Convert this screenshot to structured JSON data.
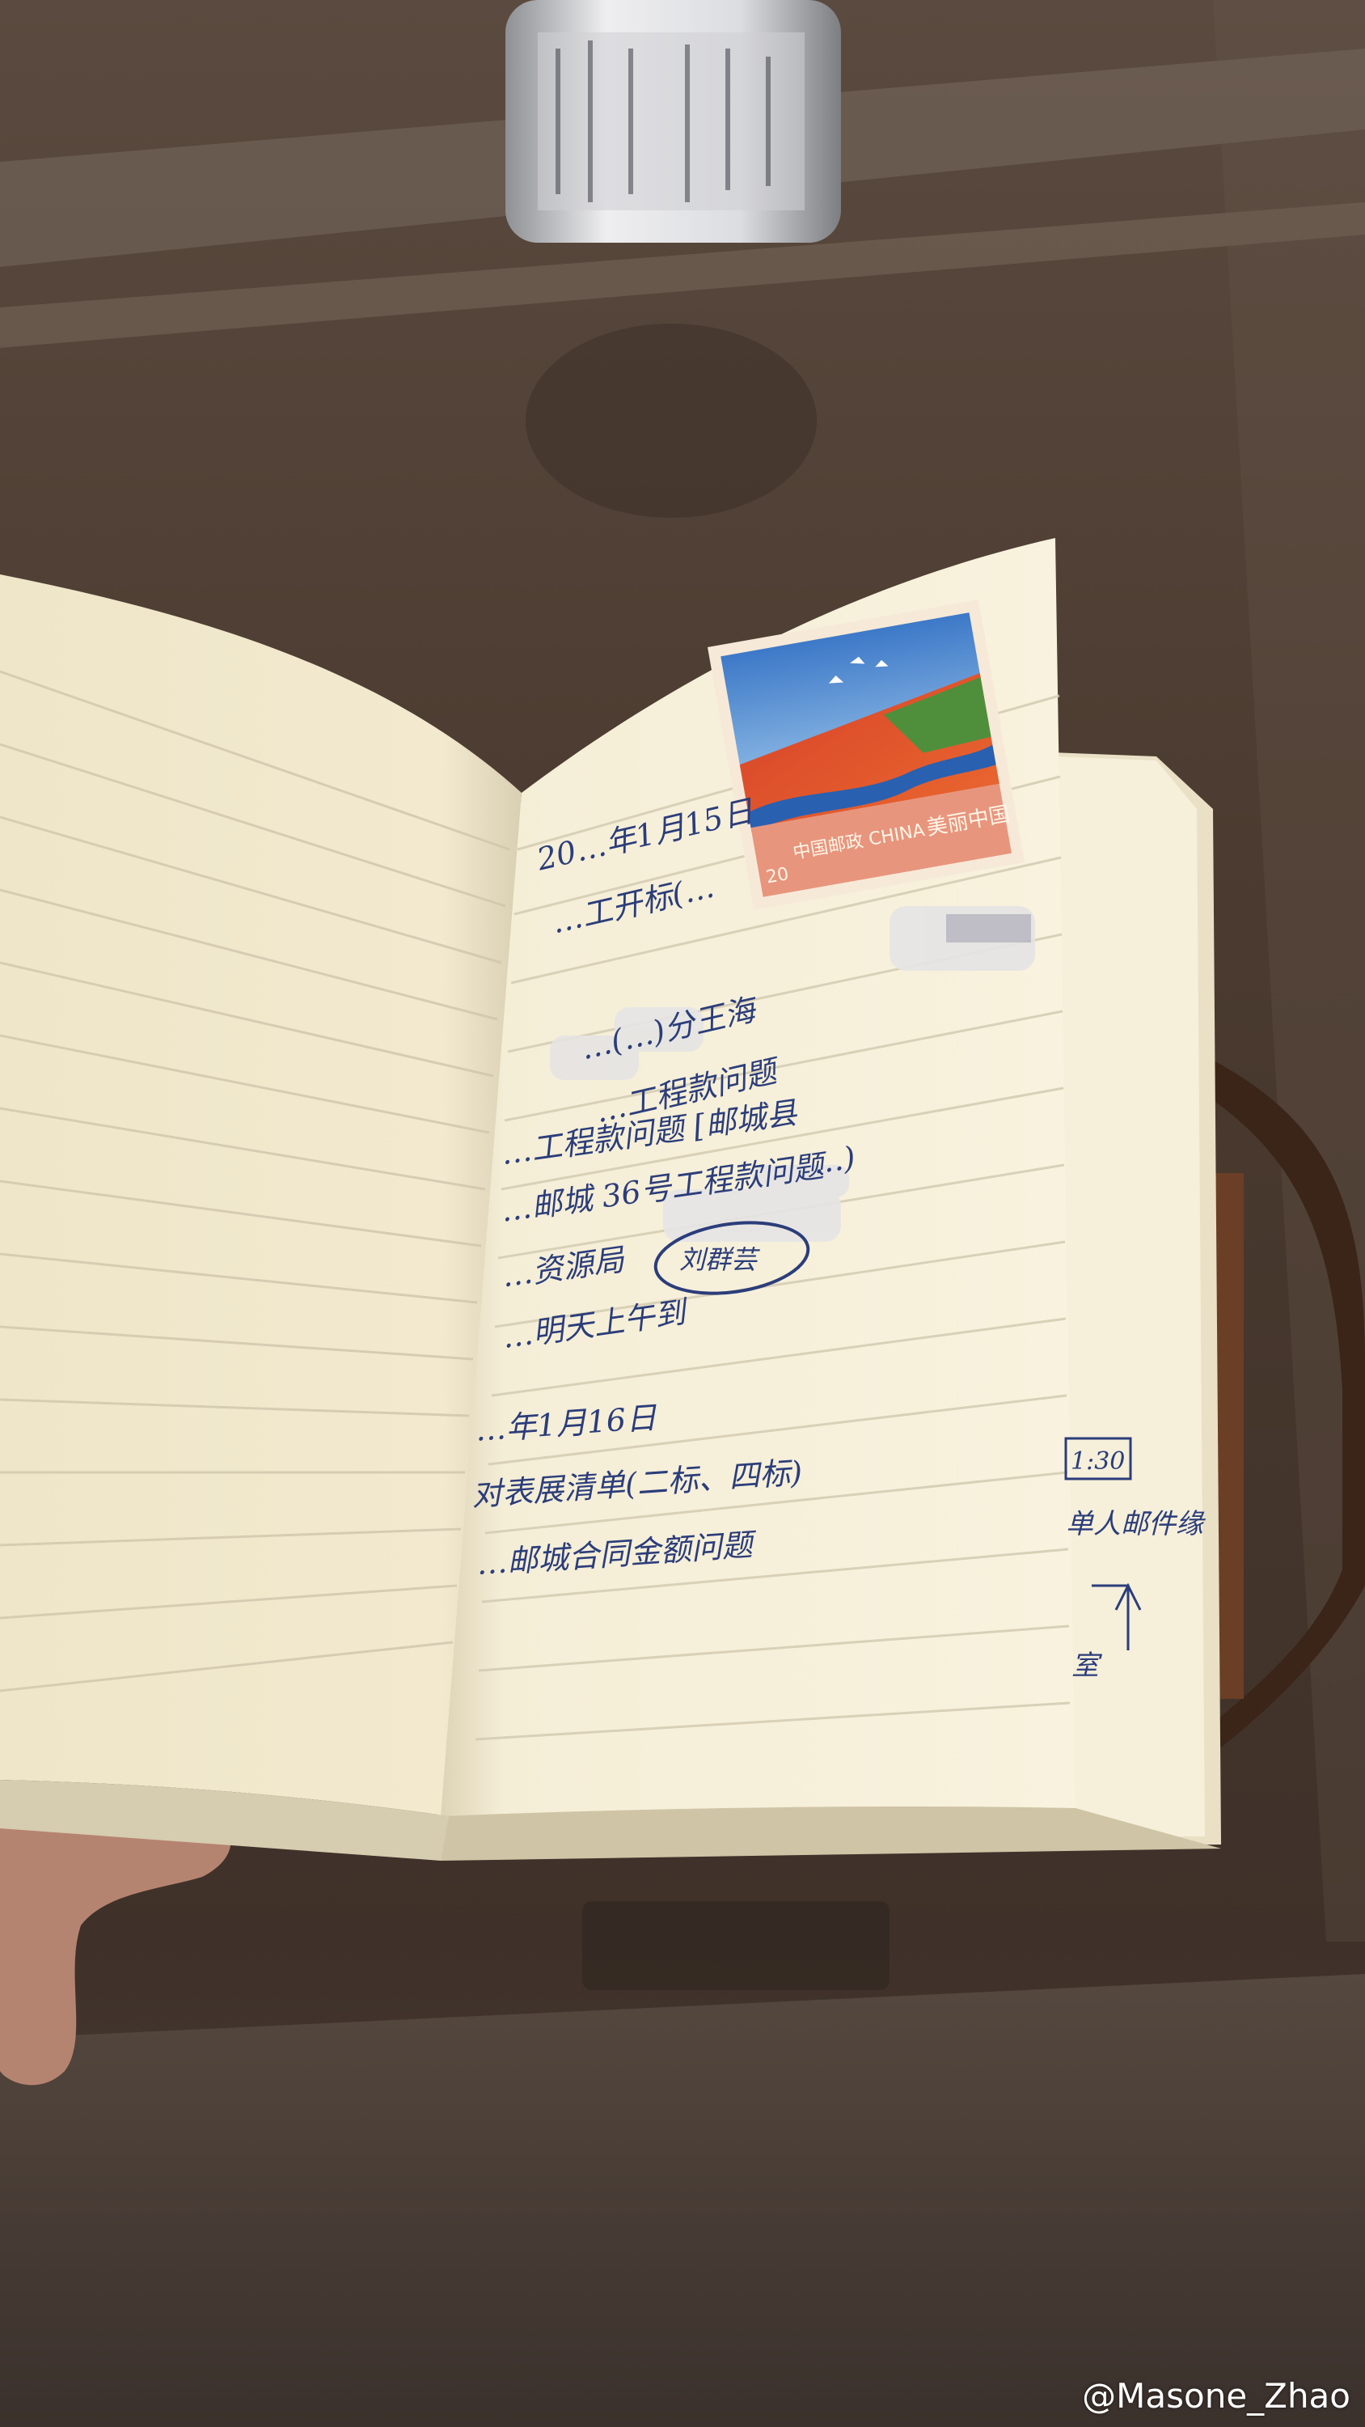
{
  "notebook": {
    "lines": [
      {
        "text": "20…年1月15日"
      },
      {
        "text": "…工开标(…"
      },
      {
        "text": "…(…)分王海"
      },
      {
        "text": "…工程款问题"
      },
      {
        "text": "…工程款问题 [邮城县"
      },
      {
        "text": "…邮城 36号工程款问题"
      },
      {
        "text": "…)"
      },
      {
        "text": "…资源局"
      },
      {
        "text": "…明天上午到"
      },
      {
        "text": "刘群芸"
      },
      {
        "text": "…年1月16日"
      },
      {
        "text": "对表展清单(二标、四标)"
      },
      {
        "text": "…邮城合同金额问题"
      }
    ],
    "right_page": {
      "box_label": "1:30",
      "side_text": "单人邮件缘",
      "arrow_label": "室"
    }
  },
  "stamp": {
    "denomination": "20",
    "issuer": "中国邮政 CHINA",
    "name": "美丽中国"
  },
  "watermark": "@Masone_Zhao",
  "colors": {
    "table": "#4a3a2f",
    "paper": "#f4ecd3",
    "ink": "#2b3d7a",
    "cover": "#5a3a2a",
    "stamp_border": "#f7e9d8"
  }
}
